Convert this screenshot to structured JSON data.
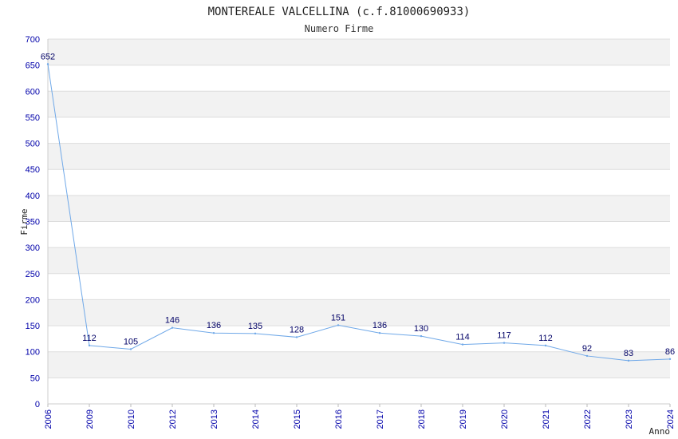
{
  "chart_data": {
    "type": "line",
    "title": "MONTEREALE VALCELLINA (c.f.81000690933)",
    "subtitle": "Numero Firme",
    "xlabel": "Anno",
    "ylabel": "Firme",
    "categories": [
      "2006",
      "2009",
      "2010",
      "2012",
      "2013",
      "2014",
      "2015",
      "2016",
      "2017",
      "2018",
      "2019",
      "2020",
      "2021",
      "2022",
      "2023",
      "2024"
    ],
    "series": [
      {
        "values": [
          652,
          112,
          105,
          146,
          136,
          135,
          128,
          151,
          136,
          130,
          114,
          117,
          112,
          92,
          83,
          86
        ]
      }
    ],
    "ylim": [
      0,
      700
    ],
    "yticks": [
      0,
      50,
      100,
      150,
      200,
      250,
      300,
      350,
      400,
      450,
      500,
      550,
      600,
      650,
      700
    ],
    "grid": true,
    "colors": {
      "line": "#6fa8e8",
      "band": "#f2f2f2",
      "axis_text": "#0000aa",
      "label_text": "#000066"
    }
  }
}
